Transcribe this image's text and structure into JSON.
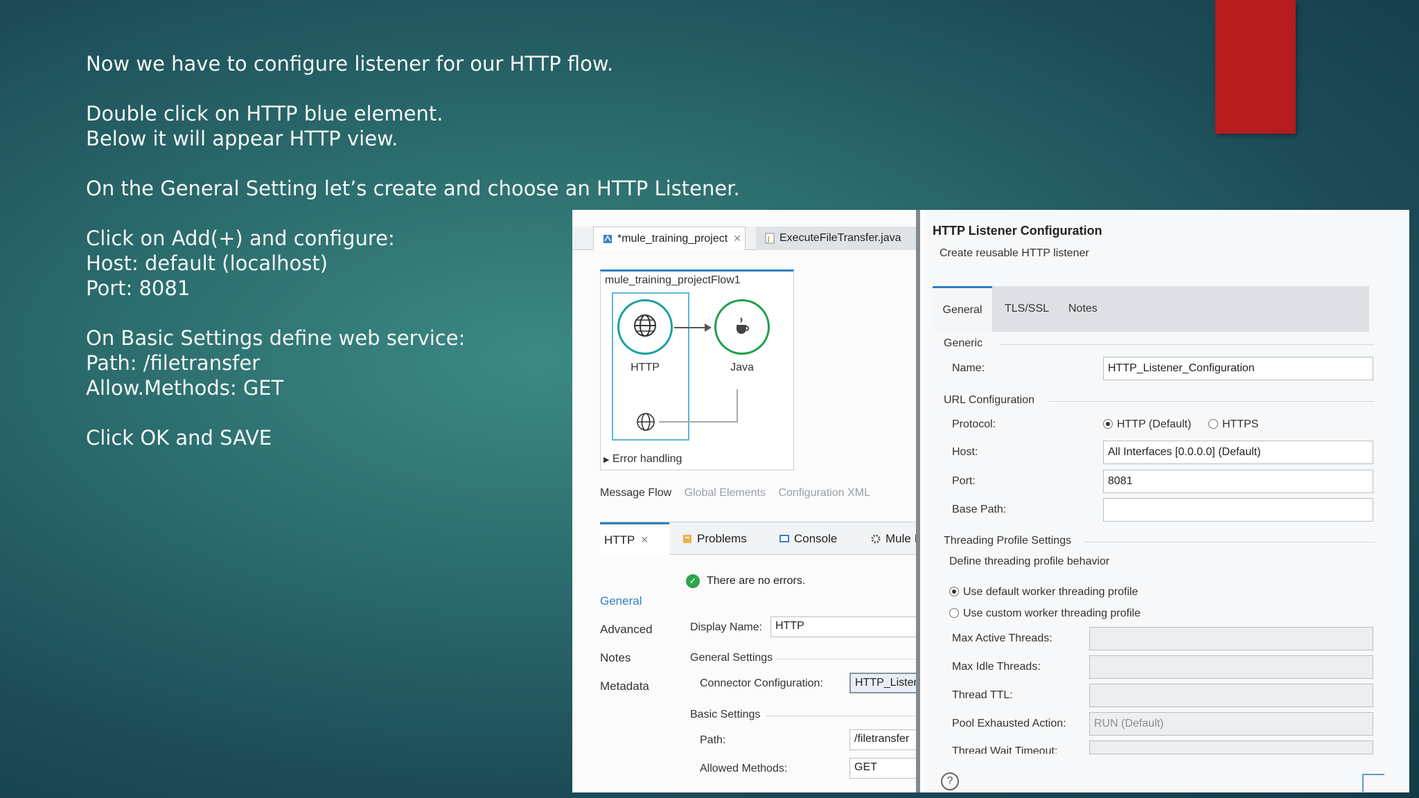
{
  "instructions": {
    "line1": "Now we have to configure  listener for our HTTP flow.",
    "line2": "Double click on HTTP blue element.",
    "line3": "Below it will appear HTTP view.",
    "line4": "On the General Setting let’s create and choose an HTTP Listener.",
    "line5": "Click on Add(+) and configure:",
    "line6": "Host: default (localhost)",
    "line7": "Port: 8081",
    "line8": "On Basic Settings define web service:",
    "line9": "Path: /filetransfer",
    "line10": "Allow.Methods: GET",
    "line11": "Click OK and SAVE"
  },
  "editor": {
    "tabs": [
      {
        "label": "*mule_training_project"
      },
      {
        "label": "ExecuteFileTransfer.java"
      }
    ],
    "flow_title": "mule_training_projectFlow1",
    "nodes": {
      "http": "HTTP",
      "java": "Java"
    },
    "error_handling": "Error handling",
    "subtabs": [
      "Message Flow",
      "Global Elements",
      "Configuration XML"
    ],
    "view_tabs": [
      "HTTP",
      "Problems",
      "Console",
      "Mule I"
    ],
    "status": "There are no errors.",
    "side_links": [
      "General",
      "Advanced",
      "Notes",
      "Metadata"
    ],
    "display_name_label": "Display Name:",
    "display_name_value": "HTTP",
    "general_settings": "General Settings",
    "connector_label": "Connector Configuration:",
    "connector_value": "HTTP_Listener",
    "basic_settings": "Basic Settings",
    "path_label": "Path:",
    "path_value": "/filetransfer",
    "methods_label": "Allowed Methods:",
    "methods_value": "GET"
  },
  "dialog": {
    "title": "HTTP Listener Configuration",
    "subtitle": "Create reusable HTTP listener",
    "tabs": [
      "General",
      "TLS/SSL",
      "Notes"
    ],
    "generic": "Generic",
    "name_label": "Name:",
    "name_value": "HTTP_Listener_Configuration",
    "url_config": "URL Configuration",
    "protocol_label": "Protocol:",
    "protocol_http": "HTTP (Default)",
    "protocol_https": "HTTPS",
    "host_label": "Host:",
    "host_value": "All Interfaces [0.0.0.0] (Default)",
    "port_label": "Port:",
    "port_value": "8081",
    "base_path_label": "Base Path:",
    "base_path_value": "",
    "threading": "Threading Profile Settings",
    "threading_desc": "Define threading profile behavior",
    "opt_default": "Use default worker threading profile",
    "opt_custom": "Use custom worker threading profile",
    "max_active_label": "Max Active Threads:",
    "max_idle_label": "Max Idle Threads:",
    "ttl_label": "Thread TTL:",
    "pool_label": "Pool Exhausted Action:",
    "pool_value": "RUN (Default)",
    "wait_label": "Thread Wait Timeout:",
    "help": "?"
  },
  "colors": {
    "accent_red": "#b81c1f",
    "link_blue": "#2f7fc1",
    "ok_green": "#2ea44f"
  }
}
